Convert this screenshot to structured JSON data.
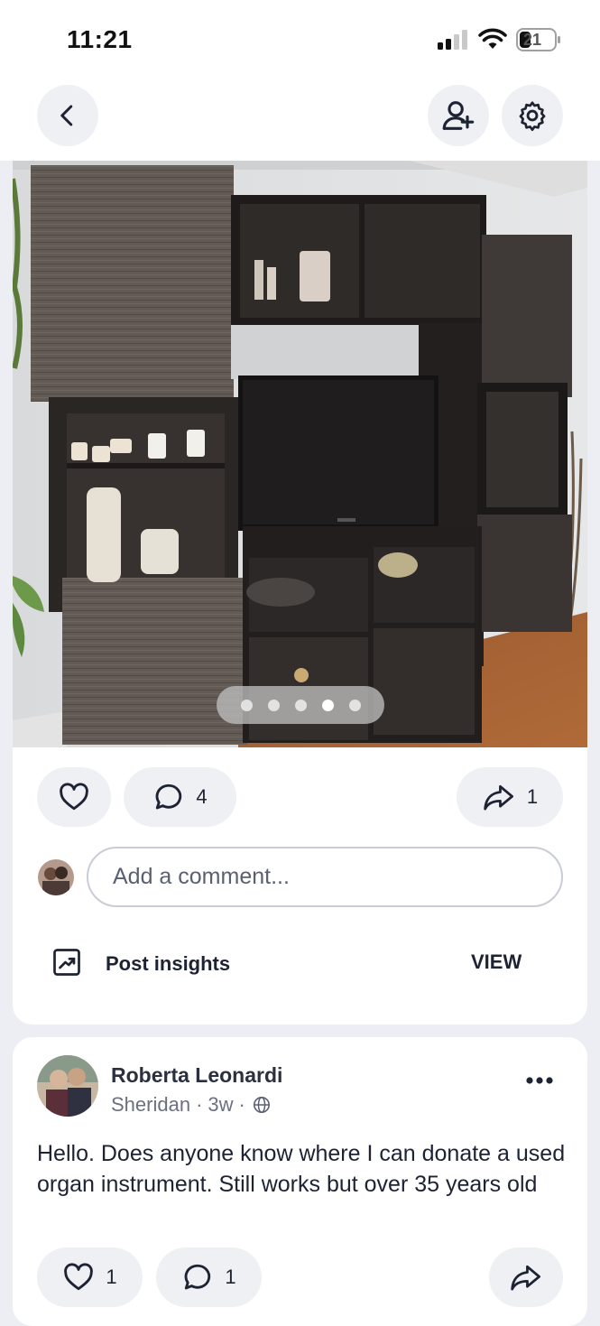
{
  "status_bar": {
    "time": "11:21",
    "battery": "21"
  },
  "top_bar": {
    "back_icon": "chevron-left-icon",
    "add_friend_icon": "user-plus-icon",
    "settings_icon": "gear-icon"
  },
  "post": {
    "carousel": {
      "total": 5,
      "active_index": 4
    },
    "actions": {
      "like_count": "",
      "comment_count": "4",
      "share_count": "1"
    },
    "comment_placeholder": "Add a comment...",
    "insights_label": "Post insights",
    "view_label": "VIEW"
  },
  "next_post": {
    "author": "Roberta Leonardi",
    "location": "Sheridan",
    "age": "3w",
    "separator": "·",
    "text": "Hello. Does anyone know where I can donate a used organ instrument.  Still works but over 35 years old",
    "like_count": "1",
    "comment_count": "1"
  },
  "colors": {
    "background": "#edeef3",
    "card": "#ffffff",
    "pill": "#eef0f4",
    "text": "#1d2333",
    "muted": "#6b7080"
  }
}
